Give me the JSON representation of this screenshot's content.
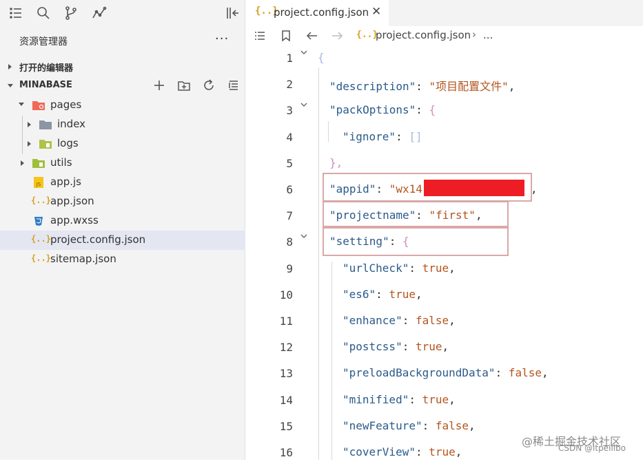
{
  "activity_bar": {
    "icons": [
      "list-icon",
      "search-icon",
      "branch-icon",
      "graph-icon",
      "collapse-panel-icon"
    ]
  },
  "explorer": {
    "title": "资源管理器",
    "more": "···",
    "open_editors_label": "打开的编辑器",
    "project_label": "MINABASE",
    "tree": [
      {
        "label": "pages",
        "icon": "folder-red-icon"
      },
      {
        "label": "index",
        "icon": "folder-gray-icon"
      },
      {
        "label": "logs",
        "icon": "folder-green-icon"
      },
      {
        "label": "utils",
        "icon": "folder-green-icon"
      },
      {
        "label": "app.js",
        "icon": "js-file-icon"
      },
      {
        "label": "app.json",
        "icon": "json-file-icon"
      },
      {
        "label": "app.wxss",
        "icon": "css-file-icon"
      },
      {
        "label": "project.config.json",
        "icon": "json-file-icon"
      },
      {
        "label": "sitemap.json",
        "icon": "json-file-icon"
      }
    ]
  },
  "editor": {
    "tab_label": "project.config.json",
    "tab_icon_text": "{..}",
    "tab_close": "✕",
    "breadcrumb_icon_text": "{..}",
    "breadcrumb_file": "project.config.json",
    "breadcrumb_sep": "›",
    "breadcrumb_ellipsis": "...",
    "lines": [
      {
        "n": "1",
        "text": "{"
      },
      {
        "n": "2",
        "key": "\"description\"",
        "colon": ": ",
        "val": "\"项目配置文件\"",
        "end": ","
      },
      {
        "n": "3",
        "key": "\"packOptions\"",
        "colon": ": ",
        "val": "{"
      },
      {
        "n": "4",
        "key": "\"ignore\"",
        "colon": ": ",
        "val": "[]"
      },
      {
        "n": "5",
        "text": "},"
      },
      {
        "n": "6",
        "key": "\"appid\"",
        "colon": ": ",
        "val": "\"wx14",
        "end": ","
      },
      {
        "n": "7",
        "key": "\"projectname\"",
        "colon": ": ",
        "val": "\"first\"",
        "end": ","
      },
      {
        "n": "8",
        "key": "\"setting\"",
        "colon": ": ",
        "val": "{"
      },
      {
        "n": "9",
        "key": "\"urlCheck\"",
        "colon": ": ",
        "val": "true",
        "end": ","
      },
      {
        "n": "10",
        "key": "\"es6\"",
        "colon": ": ",
        "val": "true",
        "end": ","
      },
      {
        "n": "11",
        "key": "\"enhance\"",
        "colon": ": ",
        "val": "false",
        "end": ","
      },
      {
        "n": "12",
        "key": "\"postcss\"",
        "colon": ": ",
        "val": "true",
        "end": ","
      },
      {
        "n": "13",
        "key": "\"preloadBackgroundData\"",
        "colon": ": ",
        "val": "false",
        "end": ","
      },
      {
        "n": "14",
        "key": "\"minified\"",
        "colon": ": ",
        "val": "true",
        "end": ","
      },
      {
        "n": "15",
        "key": "\"newFeature\"",
        "colon": ": ",
        "val": "false",
        "end": ","
      },
      {
        "n": "16",
        "key": "\"coverView\"",
        "colon": ": ",
        "val": "true",
        "end": ","
      }
    ]
  },
  "watermark": {
    "line1": "@稀土掘金技术社区",
    "line2": "CSDN @itpeilibo"
  }
}
